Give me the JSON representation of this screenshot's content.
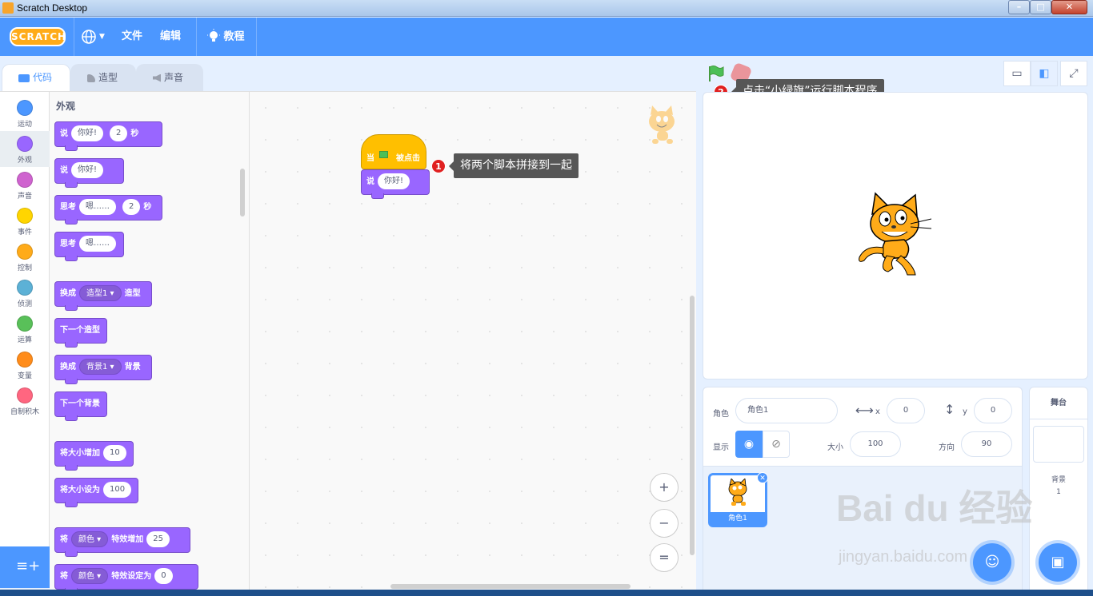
{
  "window": {
    "title": "Scratch Desktop"
  },
  "menubar": {
    "logo": "SCRATCH",
    "file": "文件",
    "edit": "编辑",
    "tutorials": "教程"
  },
  "tabs": [
    {
      "label": "代码"
    },
    {
      "label": "造型"
    },
    {
      "label": "声音"
    }
  ],
  "categories": [
    {
      "label": "运动",
      "color": "#4c97ff"
    },
    {
      "label": "外观",
      "color": "#9966ff"
    },
    {
      "label": "声音",
      "color": "#cf63cf"
    },
    {
      "label": "事件",
      "color": "#ffd500"
    },
    {
      "label": "控制",
      "color": "#ffab19"
    },
    {
      "label": "侦测",
      "color": "#5cb1d6"
    },
    {
      "label": "运算",
      "color": "#59c059"
    },
    {
      "label": "变量",
      "color": "#ff8c1a"
    },
    {
      "label": "自制积木",
      "color": "#ff6680"
    }
  ],
  "palette": {
    "heading": "外观",
    "blocks": {
      "say_secs": {
        "label": "说",
        "text": "你好!",
        "num": "2",
        "unit": "秒"
      },
      "say": {
        "label": "说",
        "text": "你好!"
      },
      "think_secs": {
        "label": "思考",
        "text": "嗯……",
        "num": "2",
        "unit": "秒"
      },
      "think": {
        "label": "思考",
        "text": "嗯……"
      },
      "switch_costume": {
        "label": "换成",
        "menu": "造型1",
        "suffix": "造型"
      },
      "next_costume": {
        "label": "下一个造型"
      },
      "switch_backdrop": {
        "label": "换成",
        "menu": "背景1",
        "suffix": "背景"
      },
      "next_backdrop": {
        "label": "下一个背景"
      },
      "change_size": {
        "label": "将大小增加",
        "num": "10"
      },
      "set_size": {
        "label": "将大小设为",
        "num": "100"
      },
      "change_effect": {
        "label": "将",
        "menu": "颜色",
        "middle": "特效增加",
        "num": "25"
      },
      "set_effect": {
        "label": "将",
        "menu": "颜色",
        "middle": "特效设定为",
        "num": "0"
      }
    }
  },
  "script": {
    "hat_prefix": "当",
    "hat_suffix": "被点击",
    "say_label": "说",
    "say_text": "你好!"
  },
  "annotations": {
    "step1_num": "1",
    "step1_text": "将两个脚本拼接到一起",
    "step2_num": "2",
    "step2_text": "点击“小绿旗”运行脚本程序"
  },
  "zoom": {
    "in": "+",
    "out": "−",
    "reset": "="
  },
  "sprite_info": {
    "sprite_label": "角色",
    "sprite_name": "角色1",
    "x_label": "x",
    "x_value": "0",
    "y_label": "y",
    "y_value": "0",
    "show_label": "显示",
    "size_label": "大小",
    "size_value": "100",
    "direction_label": "方向",
    "direction_value": "90"
  },
  "sprite_list": [
    {
      "name": "角色1"
    }
  ],
  "stage_pane": {
    "title": "舞台",
    "backdrops_label": "背景",
    "backdrops_count": "1"
  },
  "watermark": {
    "brand": "Bai du 经验",
    "url": "jingyan.baidu.com"
  },
  "colors": {
    "menubar": "#4c97ff",
    "looks": "#9966ff",
    "events": "#ffbf00",
    "annotation_badge": "#e02020"
  }
}
